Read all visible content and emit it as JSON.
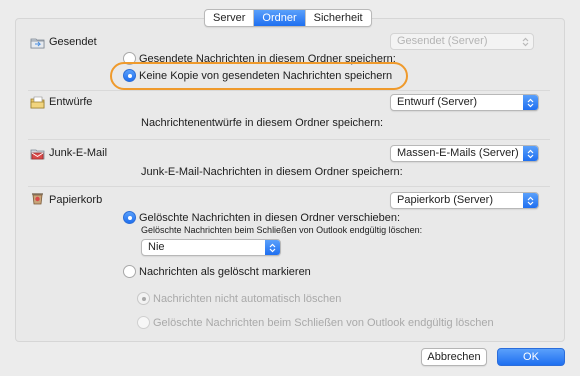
{
  "tabs": [
    "Server",
    "Ordner",
    "Sicherheit"
  ],
  "active_tab": "Ordner",
  "sent": {
    "label": "Gesendet",
    "option_save": "Gesendete Nachrichten in diesem Ordner speichern:",
    "option_nocopy": "Keine Kopie von gesendeten Nachrichten speichern",
    "folder_popup": "Gesendet (Server)"
  },
  "drafts": {
    "label": "Entwürfe",
    "folder_popup": "Entwurf (Server)",
    "description": "Nachrichtenentwürfe in diesem Ordner speichern:"
  },
  "junk": {
    "label": "Junk-E-Mail",
    "folder_popup": "Massen-E-Mails (Server)",
    "description": "Junk-E-Mail-Nachrichten in diesem Ordner speichern:"
  },
  "trash": {
    "label": "Papierkorb",
    "folder_popup": "Papierkorb (Server)",
    "option_move": "Gelöschte Nachrichten in diesen Ordner verschieben:",
    "purge_label": "Gelöschte Nachrichten beim Schließen von Outlook endgültig löschen:",
    "purge_popup": "Nie",
    "option_mark": "Nachrichten als gelöscht markieren",
    "suboption_nodelete": "Nachrichten nicht automatisch löschen",
    "suboption_purge": "Gelöschte Nachrichten beim Schließen von Outlook endgültig löschen"
  },
  "buttons": {
    "cancel": "Abbrechen",
    "ok": "OK"
  },
  "colors": {
    "accent": "#1f6ff0",
    "highlight": "#ef9a2c"
  }
}
